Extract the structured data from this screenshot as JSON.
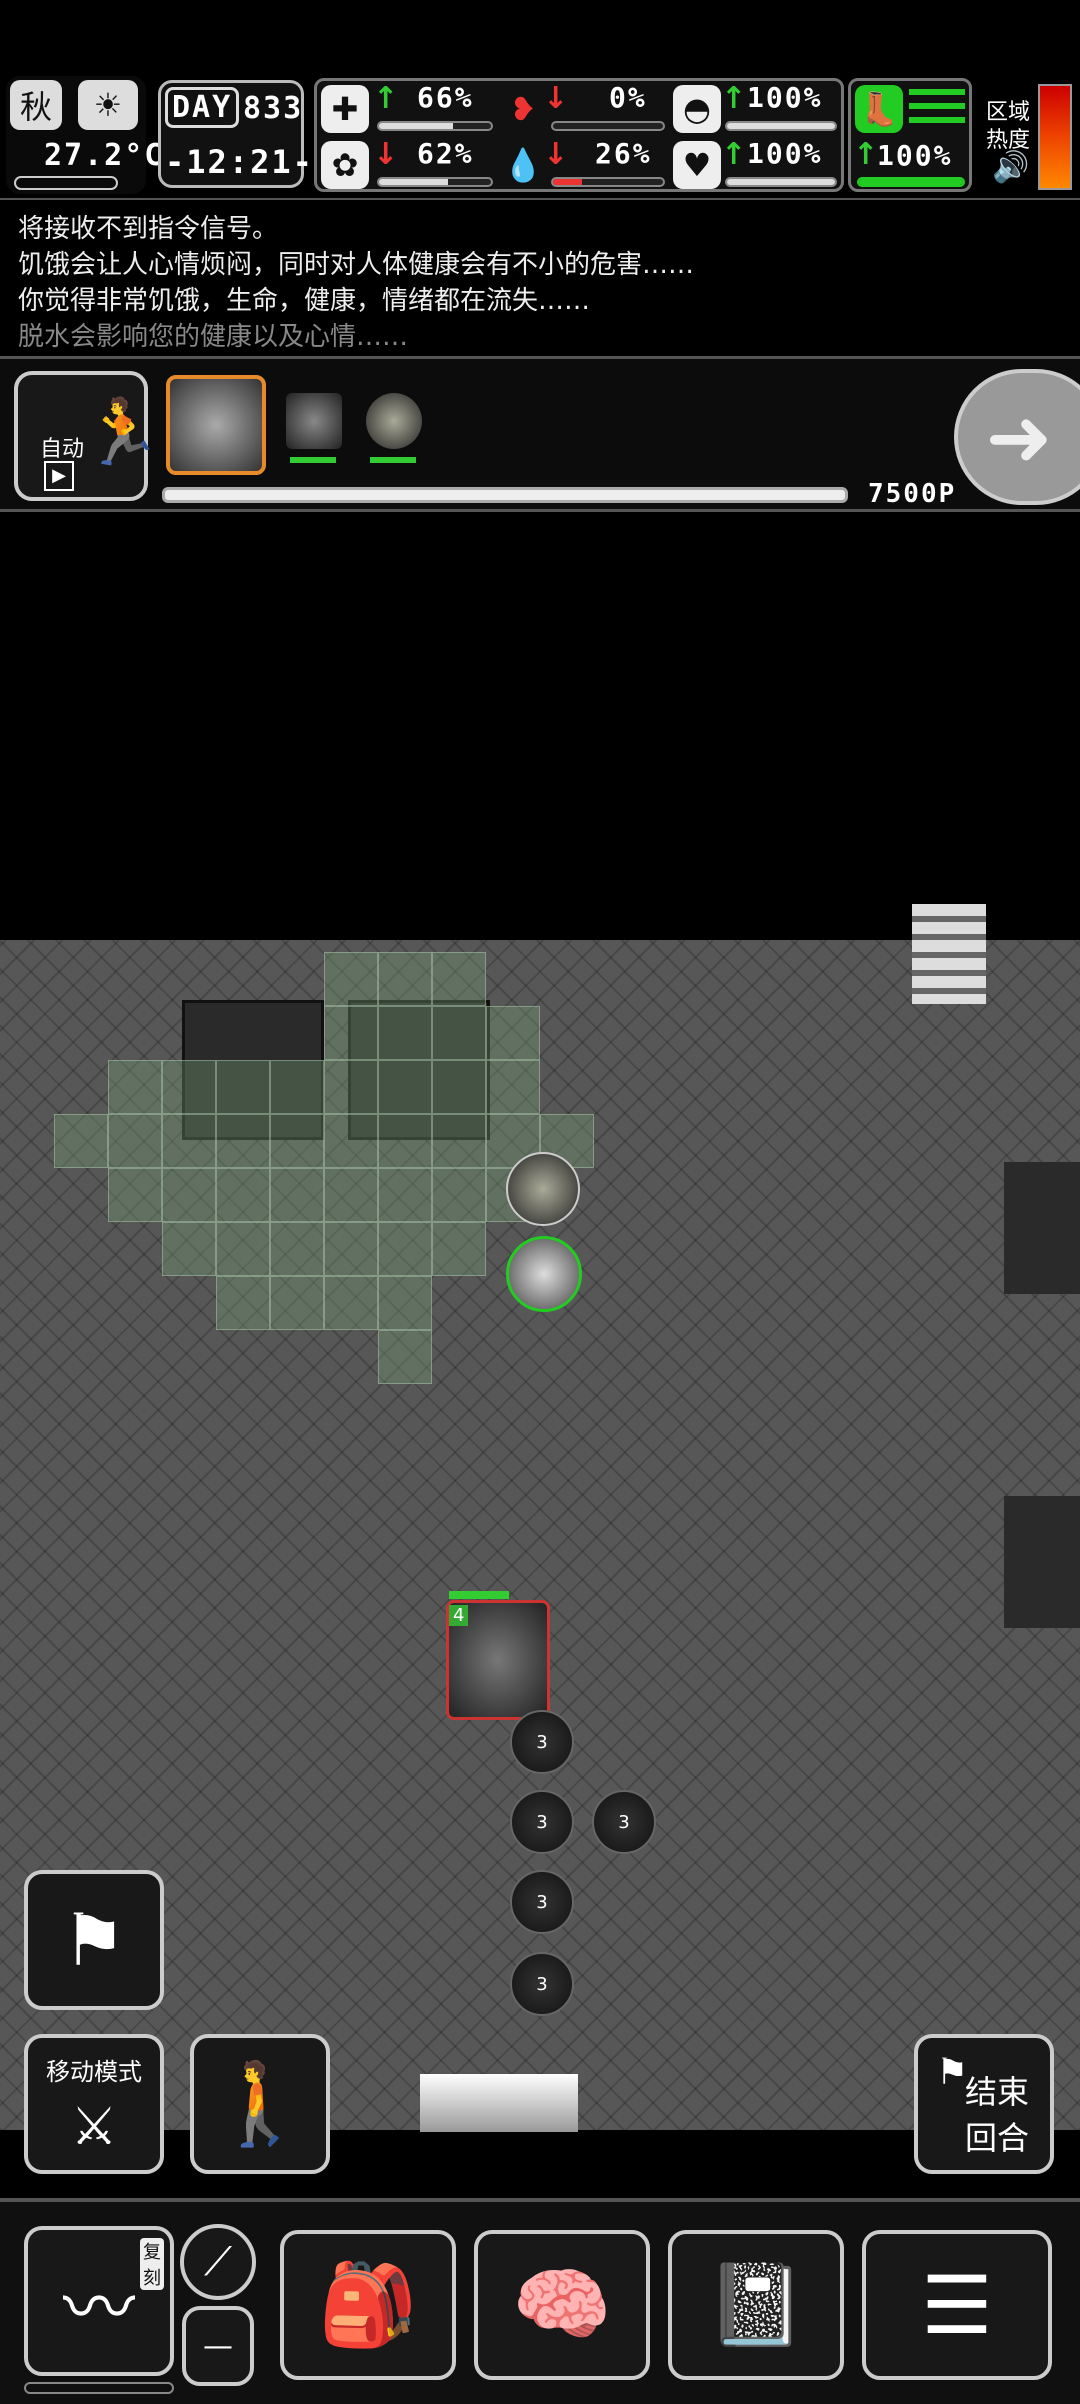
{
  "hud": {
    "season": "秋",
    "temperature": "27.2°C",
    "day_label": "DAY",
    "day_value": "833",
    "clock": "-12:21-",
    "stats": [
      {
        "key": "health",
        "icon": "medkit-icon",
        "arrow": "up",
        "value": "66%",
        "fill": 0.66
      },
      {
        "key": "hunger",
        "icon": "stomach-icon",
        "arrow": "down",
        "value": "0%",
        "fill": 0.0
      },
      {
        "key": "armor",
        "icon": "helmet-icon",
        "arrow": "up",
        "value": "100%",
        "fill": 1.0
      },
      {
        "key": "mood",
        "icon": "brain-icon",
        "arrow": "down",
        "value": "62%",
        "fill": 0.62
      },
      {
        "key": "thirst",
        "icon": "water-drop-icon",
        "arrow": "down",
        "value": "26%",
        "fill": 0.26
      },
      {
        "key": "life",
        "icon": "heart-icon",
        "arrow": "up",
        "value": "100%",
        "fill": 1.0
      }
    ],
    "stamina": {
      "arrow": "up",
      "value": "100%",
      "fill": 1.0
    },
    "zone_heat_label_1": "区域",
    "zone_heat_label_2": "热度"
  },
  "messages": [
    "将接收不到指令信号。",
    "饥饿会让人心情烦闷，同时对人体健康会有不小的危害……",
    "你觉得非常饥饿，生命，健康，情绪都在流失……",
    "脱水会影响您的健康以及心情……"
  ],
  "turn_bar": {
    "auto_label": "自动",
    "ap_text": "7500P",
    "progress": 1.0
  },
  "controls": {
    "move_mode_label": "移动模式",
    "end_turn_line1": "结束",
    "end_turn_line2": "回合",
    "unit_level": "4",
    "copy_label": "复刻"
  },
  "enemy_counts": [
    "3",
    "3",
    "3",
    "3",
    "3"
  ]
}
